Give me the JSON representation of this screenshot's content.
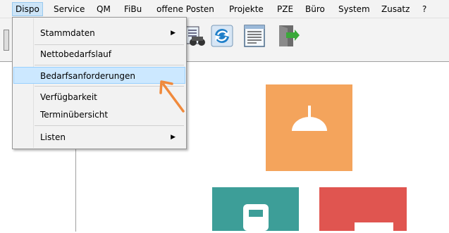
{
  "menubar": {
    "items": [
      "Dispo",
      "Service",
      "QM",
      "FiBu",
      "offene Posten",
      "Projekte",
      "PZE",
      "Büro",
      "System",
      "Zusatz",
      "?"
    ]
  },
  "dropdown": {
    "items": [
      {
        "label": "Stammdaten",
        "submenu": true
      },
      {
        "label": "Nettobedarfslauf",
        "submenu": false
      },
      {
        "label": "Bedarfsanforderungen",
        "submenu": false,
        "highlighted": true
      },
      {
        "label": "Verfügbarkeit",
        "submenu": false
      },
      {
        "label": "Terminübersicht",
        "submenu": false
      },
      {
        "label": "Listen",
        "submenu": true
      }
    ],
    "submenu_glyph": "▶"
  },
  "toolbar": {
    "icons": [
      "binoculars-icon",
      "refresh-icon",
      "list-icon",
      "exit-door-icon"
    ]
  },
  "tiles": {
    "colors": {
      "orange": "#f4a45c",
      "teal": "#3d9e98",
      "red": "#e05550"
    },
    "tile_icons": [
      "lamp-icon",
      "phone-icon",
      "document-icon"
    ]
  },
  "annotation": {
    "color": "#f08a3c"
  }
}
